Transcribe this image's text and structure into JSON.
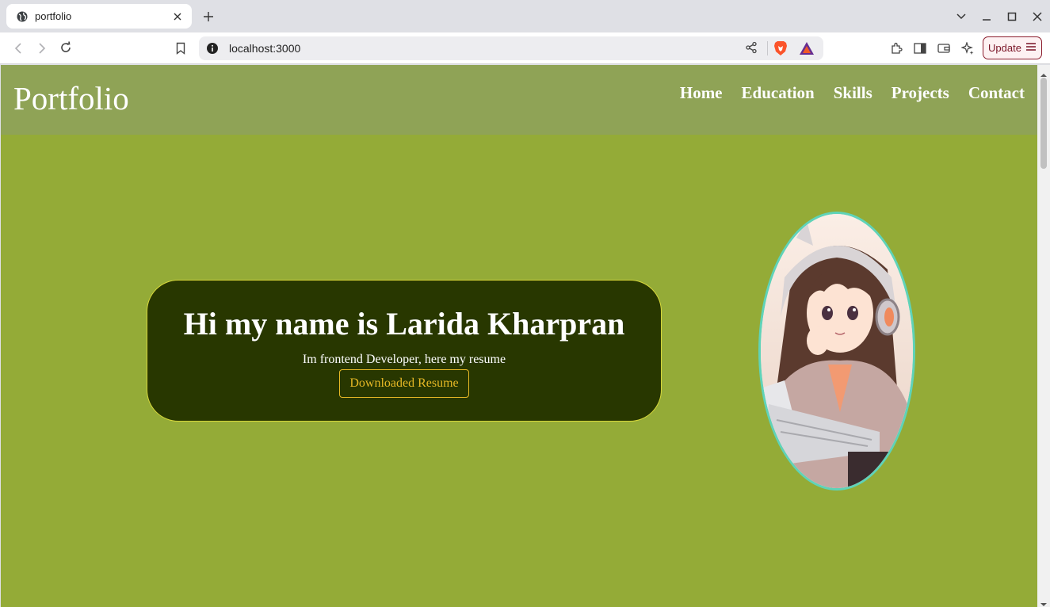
{
  "browser": {
    "tab_title": "portfolio",
    "url": "localhost:3000",
    "update_label": "Update"
  },
  "site": {
    "logo": "Portfolio",
    "nav": [
      "Home",
      "Education",
      "Skills",
      "Projects",
      "Contact"
    ],
    "hero": {
      "title": "Hi my name is Larida Kharpran",
      "subtitle": "Im frontend Developer, here my resume",
      "button": "Downloaded Resume"
    }
  },
  "colors": {
    "page_bg": "#94ab37",
    "header_bg": "#8fa356",
    "card_bg": "#283700",
    "card_border": "#d8d83a",
    "button_accent": "#e6b825",
    "avatar_border": "#5fd3b8"
  },
  "icons": {
    "tab": "globe-icon",
    "avatar": "anime-girl-with-headphones-illustration"
  }
}
